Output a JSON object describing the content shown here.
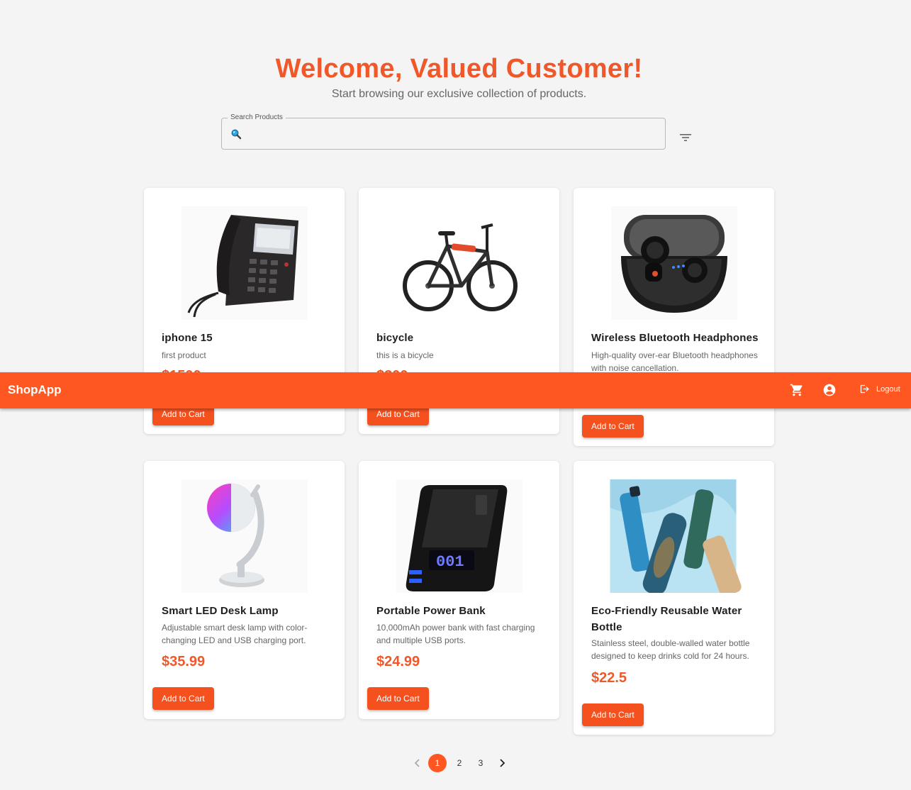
{
  "hero": {
    "title": "Welcome, Valued Customer!",
    "subtitle": "Start browsing our exclusive collection of products."
  },
  "search": {
    "label": "Search Products",
    "value": ""
  },
  "products": [
    {
      "name": "iphone 15",
      "description": "first product",
      "price": "$1500",
      "button": "Add to Cart",
      "image": "desk-telephone"
    },
    {
      "name": "bicycle",
      "description": "this is a bicycle",
      "price": "$300",
      "button": "Add to Cart",
      "image": "electric-bicycle"
    },
    {
      "name": "Wireless Bluetooth Headphones",
      "description": "High-quality over-ear Bluetooth headphones with noise cancellation.",
      "price": "",
      "button": "Add to Cart",
      "image": "wireless-earbuds-case"
    },
    {
      "name": "Smart LED Desk Lamp",
      "description": "Adjustable smart desk lamp with color-changing LED and USB charging port.",
      "price": "$35.99",
      "button": "Add to Cart",
      "image": "led-desk-lamp"
    },
    {
      "name": "Portable Power Bank",
      "description": "10,000mAh power bank with fast charging and multiple USB ports.",
      "price": "$24.99",
      "button": "Add to Cart",
      "image": "power-bank"
    },
    {
      "name": "Eco-Friendly Reusable Water Bottle",
      "description": "Stainless steel, double-walled water bottle designed to keep drinks cold for 24 hours.",
      "price": "$22.5",
      "button": "Add to Cart",
      "image": "water-bottles"
    }
  ],
  "appbar": {
    "brand": "ShopApp",
    "logout": "Logout",
    "icons": [
      "cart-icon",
      "account-icon",
      "logout-icon"
    ]
  },
  "pagination": {
    "pages": [
      "1",
      "2",
      "3"
    ],
    "current": "1"
  },
  "colors": {
    "accent": "#ff5722",
    "title": "#f0582a",
    "background": "#f4f4f4"
  }
}
